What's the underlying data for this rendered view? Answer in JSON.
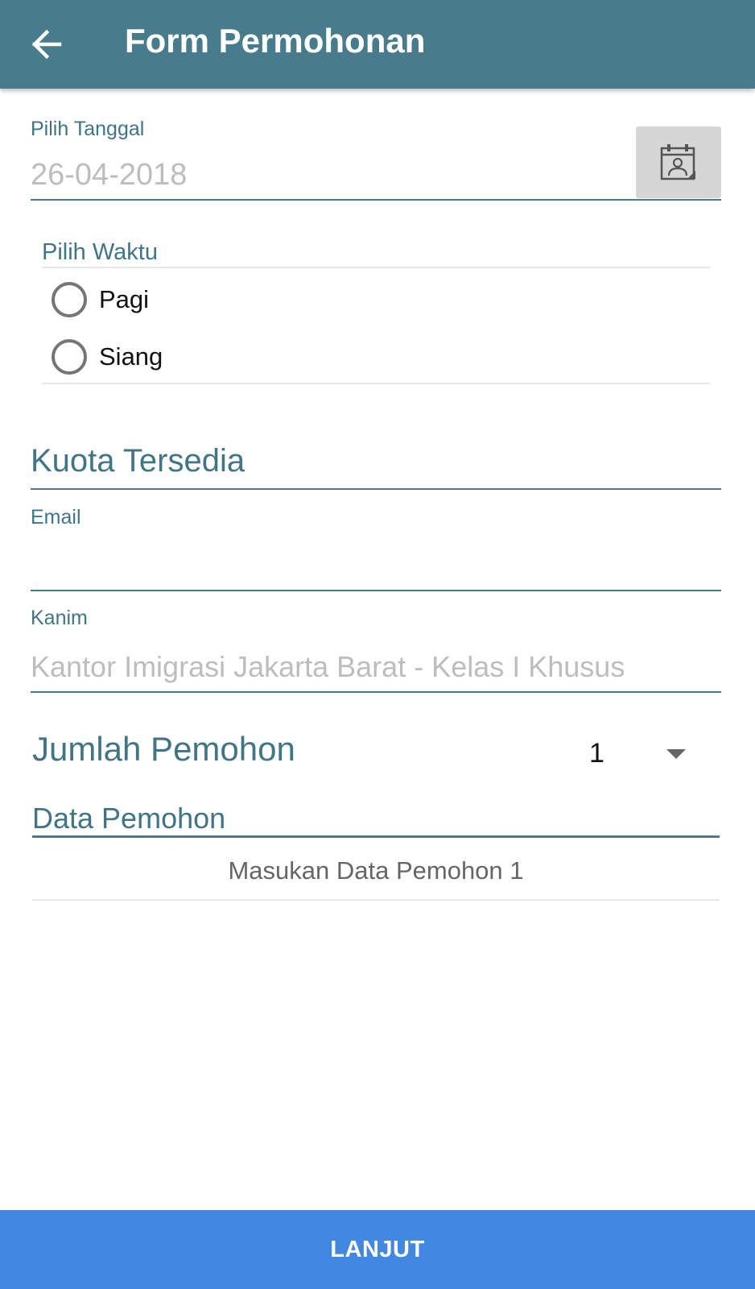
{
  "toolbar": {
    "title": "Form Permohonan",
    "back_icon": "arrow-left-icon"
  },
  "tanggal": {
    "label": "Pilih Tanggal",
    "value": "26-04-2018",
    "calendar_icon": "calendar-icon"
  },
  "waktu": {
    "label": "Pilih Waktu",
    "options": [
      {
        "label": "Pagi",
        "selected": false
      },
      {
        "label": "Siang",
        "selected": false
      }
    ]
  },
  "kuota": {
    "label": "Kuota Tersedia"
  },
  "email": {
    "label": "Email",
    "value": ""
  },
  "kanim": {
    "label": "Kanim",
    "value": "Kantor Imigrasi Jakarta Barat - Kelas I Khusus"
  },
  "jumlah": {
    "label": "Jumlah Pemohon",
    "selected": "1"
  },
  "data_pemohon": {
    "label": "Data Pemohon",
    "items": [
      "Masukan Data Pemohon 1"
    ]
  },
  "footer": {
    "lanjut_label": "LANJUT"
  },
  "colors": {
    "toolbar": "#487b8b",
    "accent_text": "#3f7585",
    "button": "#4287e1",
    "hint": "#bdbdbd"
  }
}
